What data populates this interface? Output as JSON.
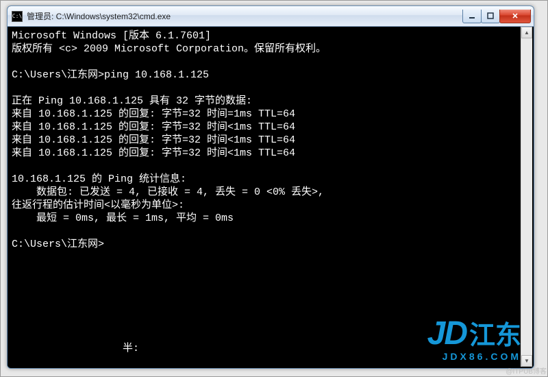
{
  "window": {
    "icon_label": "C:\\",
    "title": "管理员: C:\\Windows\\system32\\cmd.exe",
    "buttons": {
      "minimize_name": "minimize-button",
      "maximize_name": "maximize-button",
      "close_name": "close-button"
    }
  },
  "terminal": {
    "lines": [
      "Microsoft Windows [版本 6.1.7601]",
      "版权所有 <c> 2009 Microsoft Corporation。保留所有权利。",
      "",
      "C:\\Users\\江东网>ping 10.168.1.125",
      "",
      "正在 Ping 10.168.1.125 具有 32 字节的数据:",
      "来自 10.168.1.125 的回复: 字节=32 时间=1ms TTL=64",
      "来自 10.168.1.125 的回复: 字节=32 时间<1ms TTL=64",
      "来自 10.168.1.125 的回复: 字节=32 时间<1ms TTL=64",
      "来自 10.168.1.125 的回复: 字节=32 时间<1ms TTL=64",
      "",
      "10.168.1.125 的 Ping 统计信息:",
      "    数据包: 已发送 = 4, 已接收 = 4, 丢失 = 0 <0% 丢失>,",
      "往返行程的估计时间<以毫秒为单位>:",
      "    最短 = 0ms, 最长 = 1ms, 平均 = 0ms",
      "",
      "C:\\Users\\江东网>",
      "",
      "",
      "",
      "",
      "",
      "",
      "",
      "                  半:"
    ]
  },
  "logo": {
    "jd": "JD",
    "cn": "江东",
    "sub": "JDX86.COM"
  },
  "watermark": "@ITPUB博客"
}
